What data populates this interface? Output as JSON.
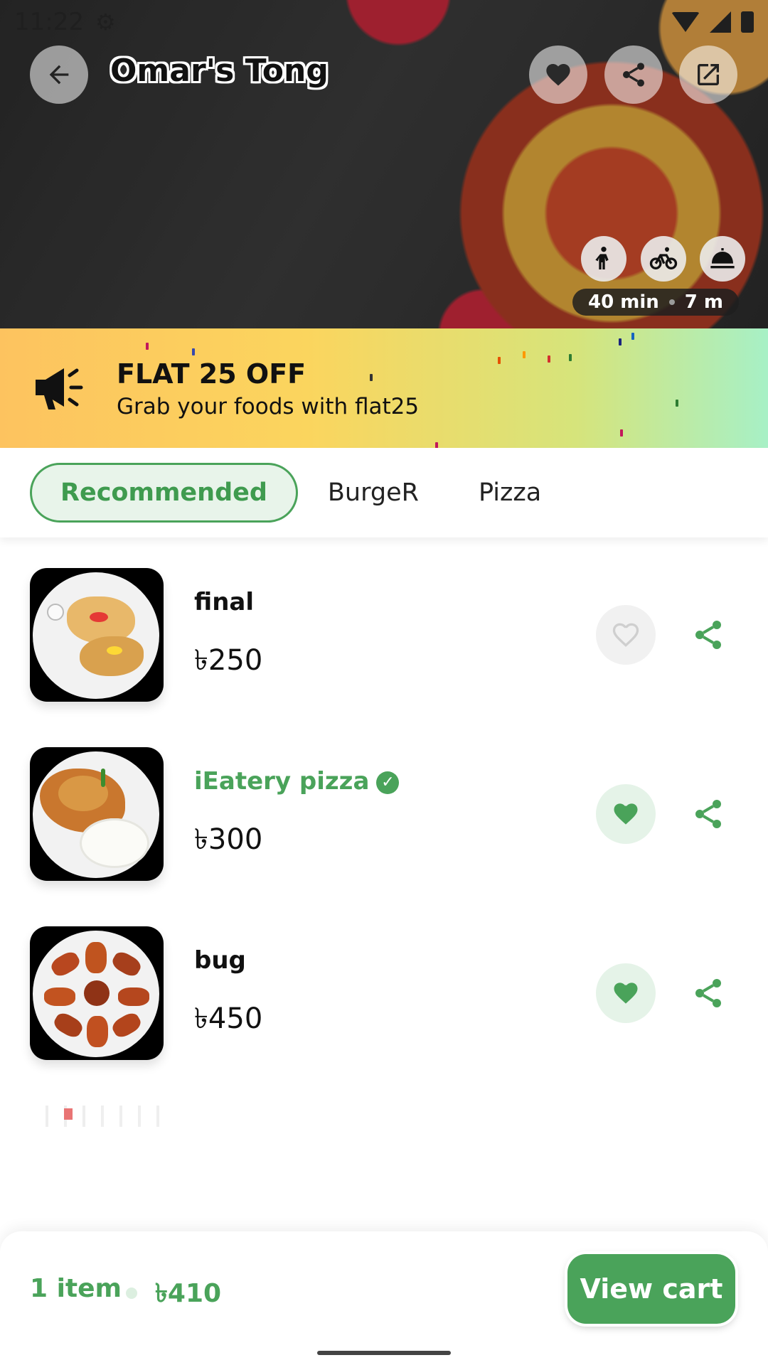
{
  "status_bar": {
    "time": "11:22",
    "icons": [
      "gear-icon",
      "wifi-icon",
      "cell-signal-icon",
      "battery-icon"
    ]
  },
  "header": {
    "title": "Omar's Tong",
    "actions": [
      "back-arrow-icon",
      "heart-icon",
      "share-icon",
      "open-external-icon"
    ]
  },
  "services": [
    "pickup-icon",
    "bicycle-delivery-icon",
    "dine-in-icon"
  ],
  "eta": {
    "time": "40 min",
    "distance": "7 m"
  },
  "promo": {
    "title": "FLAT 25 OFF",
    "subtitle": "Grab your foods with flat25",
    "icon": "megaphone-icon"
  },
  "tabs": [
    {
      "label": "Recommended",
      "active": true
    },
    {
      "label": "BurgeR",
      "active": false
    },
    {
      "label": "Pizza",
      "active": false
    }
  ],
  "items": [
    {
      "name": "final",
      "price": "৳250",
      "liked": false,
      "verified": false,
      "image": "tacos"
    },
    {
      "name": "iEatery pizza",
      "price": "৳300",
      "liked": true,
      "verified": true,
      "image": "chicken-rice"
    },
    {
      "name": "bug",
      "price": "৳450",
      "liked": true,
      "verified": false,
      "image": "chicken-wings"
    }
  ],
  "cart": {
    "count": "1 item",
    "total": "৳410",
    "button": "View cart"
  },
  "colors": {
    "accent": "#4aa35a",
    "accent_light": "#e5f3e8"
  }
}
